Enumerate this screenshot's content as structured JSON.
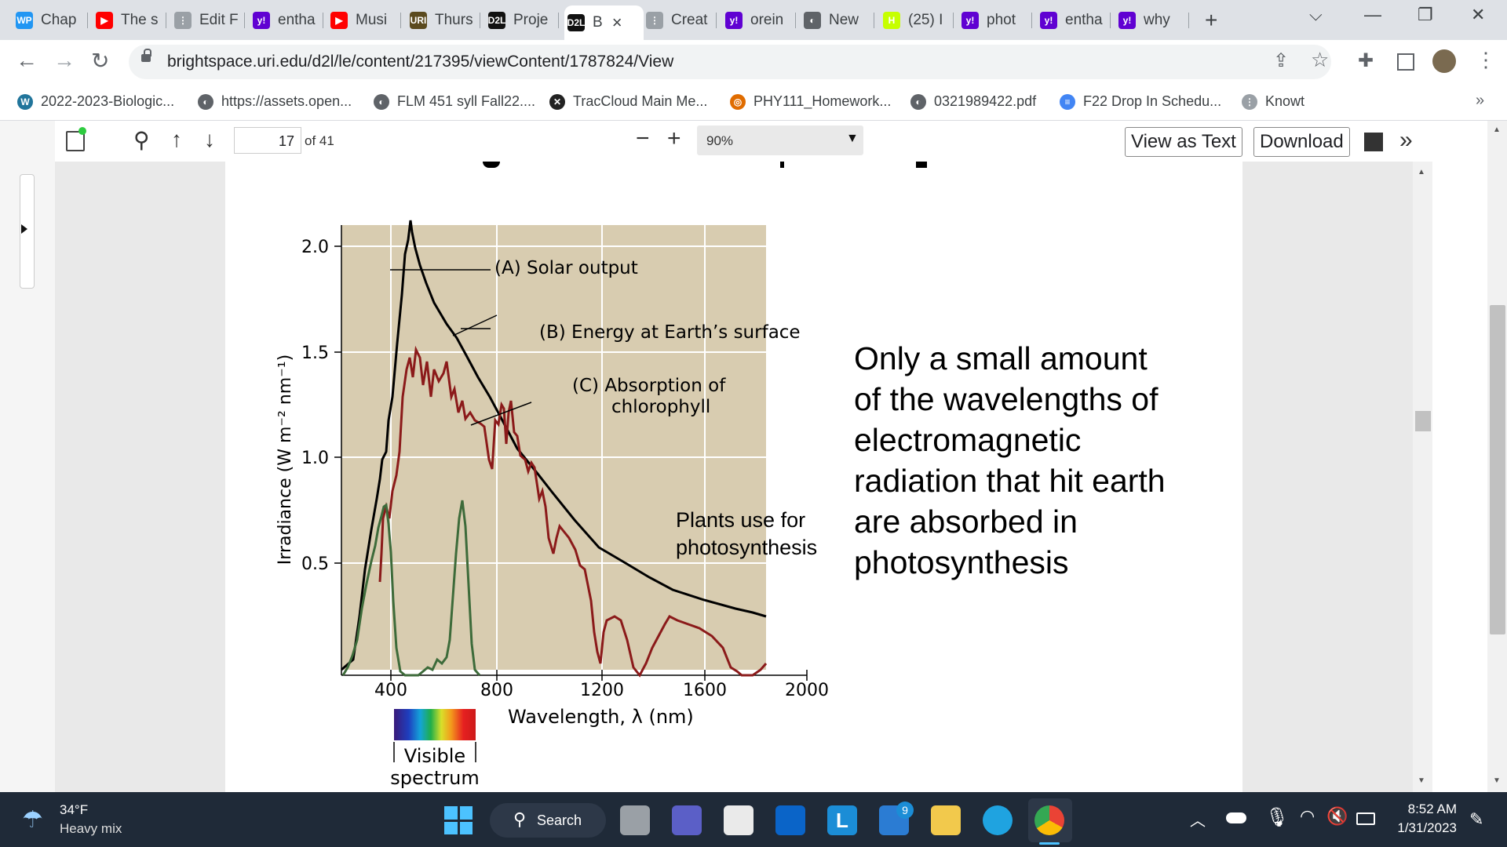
{
  "tabs": [
    {
      "label": "Chap",
      "favicon": "WP",
      "color": "#2196f3"
    },
    {
      "label": "The s",
      "favicon": "▶",
      "color": "#ff0000"
    },
    {
      "label": "Edit F",
      "favicon": "⋮",
      "color": "#9aa0a6"
    },
    {
      "label": "entha",
      "favicon": "y!",
      "color": "#6001d2"
    },
    {
      "label": "Musi",
      "favicon": "▶",
      "color": "#ff0000"
    },
    {
      "label": "Thurs",
      "favicon": "URI",
      "color": "#5b4a1e"
    },
    {
      "label": "Proje",
      "favicon": "D2L",
      "color": "#111111"
    },
    {
      "label": "B",
      "favicon": "D2L",
      "color": "#111111"
    },
    {
      "label": "Creat",
      "favicon": "⋮",
      "color": "#9aa0a6"
    },
    {
      "label": "orein",
      "favicon": "y!",
      "color": "#6001d2"
    },
    {
      "label": "New",
      "favicon": "◐",
      "color": "#5f6368"
    },
    {
      "label": "(25) I",
      "favicon": "H",
      "color": "#c6ff00"
    },
    {
      "label": "phot",
      "favicon": "y!",
      "color": "#6001d2"
    },
    {
      "label": "entha",
      "favicon": "y!",
      "color": "#6001d2"
    },
    {
      "label": "why",
      "favicon": "y!",
      "color": "#6001d2"
    }
  ],
  "active_tab_close": "×",
  "new_tab": "+",
  "url": "brightspace.uri.edu/d2l/le/content/217395/viewContent/1787824/View",
  "bookmarks": [
    {
      "label": "2022-2023-Biologic...",
      "icon": "wordpress-icon",
      "glyph": "W",
      "color": "#21759b"
    },
    {
      "label": "https://assets.open...",
      "icon": "globe-icon",
      "glyph": "◐",
      "color": "#5f6368"
    },
    {
      "label": "FLM 451 syll Fall22....",
      "icon": "globe-icon",
      "glyph": "◐",
      "color": "#5f6368"
    },
    {
      "label": "TracCloud Main Me...",
      "icon": "traccloud-icon",
      "glyph": "✕",
      "color": "#222222"
    },
    {
      "label": "PHY111_Homework...",
      "icon": "physics-icon",
      "glyph": "◎",
      "color": "#e06c00"
    },
    {
      "label": "0321989422.pdf",
      "icon": "globe-icon",
      "glyph": "◐",
      "color": "#5f6368"
    },
    {
      "label": "F22 Drop In Schedu...",
      "icon": "docs-icon",
      "glyph": "≡",
      "color": "#4285f4"
    },
    {
      "label": "Knowt",
      "icon": "knowt-icon",
      "glyph": "⋮",
      "color": "#9aa0a6"
    }
  ],
  "pdf": {
    "page_current": "17",
    "page_total": "of 41",
    "zoom": "90%",
    "view_as_text": "View as Text",
    "download": "Download"
  },
  "figure": {
    "y_ticks": [
      "2.0",
      "1.5",
      "1.0",
      "0.5"
    ],
    "x_ticks": [
      "400",
      "800",
      "1200",
      "1600",
      "2000"
    ],
    "ylabel": "Irradiance (W m⁻² nm⁻¹)",
    "xlabel": "Wavelength, λ (nm)",
    "label_a": "(A) Solar output",
    "label_b": "(B) Energy at Earth’s surface",
    "label_c1": "(C) Absorption of",
    "label_c2": "chlorophyll",
    "plants1": "Plants use for",
    "plants2": "photosynthesis",
    "visible1": "Visible",
    "visible2": "spectrum"
  },
  "slide_text": [
    "Only a small amount",
    "of the wavelengths of",
    "electromagnetic",
    "radiation that hit earth",
    "are absorbed in",
    "photosynthesis"
  ],
  "taskbar": {
    "temp": "34°F",
    "weather": "Heavy mix",
    "search": "Search",
    "badge": "9",
    "time": "8:52 AM",
    "date": "1/31/2023"
  }
}
